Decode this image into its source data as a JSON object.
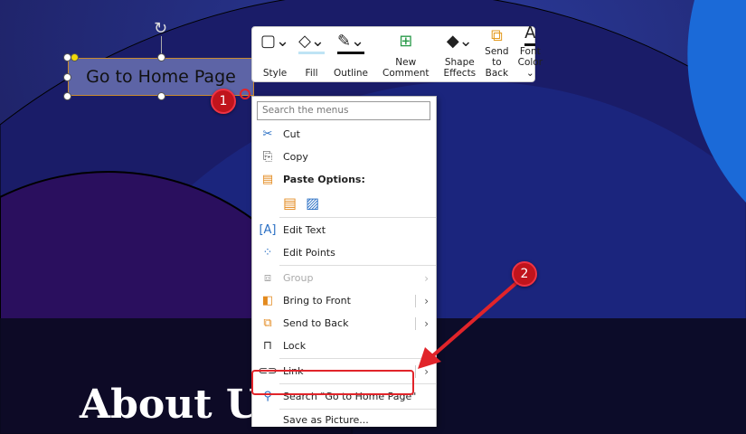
{
  "slide": {
    "title": "About U",
    "shape_text": "Go to Home Page"
  },
  "badges": [
    "1",
    "2"
  ],
  "mini_toolbar": [
    {
      "icon": "style-icon",
      "label": "Style"
    },
    {
      "icon": "fill-icon",
      "label": "Fill"
    },
    {
      "icon": "outline-icon",
      "label": "Outline"
    },
    {
      "icon": "new-comment-icon",
      "label": "New Comment"
    },
    {
      "icon": "shape-effects-icon",
      "label": "Shape Effects"
    },
    {
      "icon": "send-to-back-icon",
      "label": "Send to Back"
    },
    {
      "icon": "font-color-icon",
      "label": "Font Color ⌄"
    }
  ],
  "menu": {
    "search_placeholder": "Search the menus",
    "cut": "Cut",
    "copy": "Copy",
    "paste_options": "Paste Options:",
    "edit_text": "Edit Text",
    "edit_points": "Edit Points",
    "group": "Group",
    "bring_to_front": "Bring to Front",
    "send_to_back": "Send to Back",
    "lock": "Lock",
    "link": "Link",
    "search_item": "Search \"Go to Home Page\"",
    "save_as_picture": "Save as Picture..."
  },
  "colors": {
    "accent": "#e1242a",
    "badge": "#c0141c"
  }
}
